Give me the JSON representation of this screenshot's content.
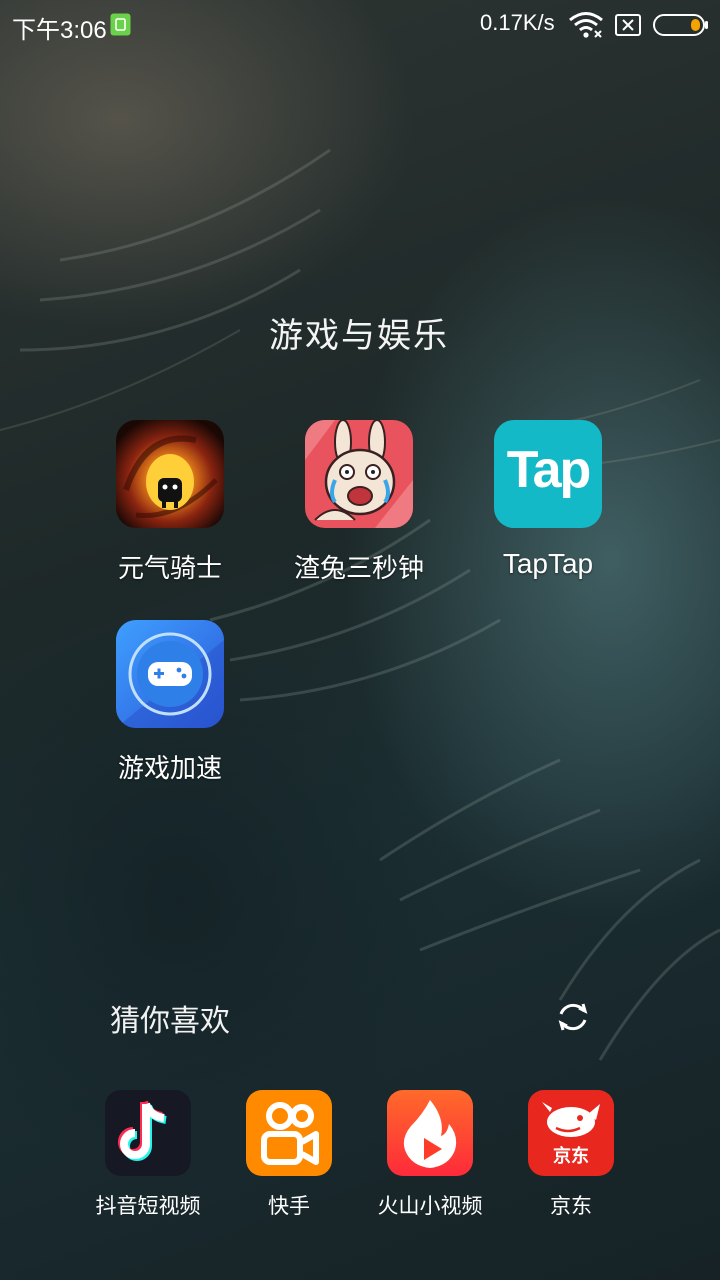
{
  "status_bar": {
    "time": "下午3:06",
    "net_speed": "0.17K/s",
    "icons": [
      "sim-card-icon",
      "wifi-icon",
      "no-sim-icon",
      "battery-icon"
    ]
  },
  "folder": {
    "title": "游戏与娱乐",
    "apps": [
      {
        "label": "元气骑士",
        "icon": "soul-knight-icon"
      },
      {
        "label": "渣兔三秒钟",
        "icon": "rabbit-game-icon"
      },
      {
        "label": "TapTap",
        "icon": "taptap-icon"
      },
      {
        "label": "游戏加速",
        "icon": "game-booster-icon"
      }
    ],
    "taptap_logo_text": "Tap"
  },
  "recommend": {
    "title": "猜你喜欢",
    "refresh_icon": "refresh-icon",
    "apps": [
      {
        "label": "抖音短视频",
        "icon": "douyin-icon"
      },
      {
        "label": "快手",
        "icon": "kuaishou-icon"
      },
      {
        "label": "火山小视频",
        "icon": "huoshan-icon"
      },
      {
        "label": "京东",
        "icon": "jd-icon"
      }
    ],
    "jd_logo_text": "京东"
  },
  "colors": {
    "taptap": "#14b9c8",
    "booster": "#2f6fe0",
    "kuaishou": "#ff8a00",
    "huoshan": "#ff3b2a",
    "jd": "#e8281e",
    "douyin": "#161823"
  }
}
